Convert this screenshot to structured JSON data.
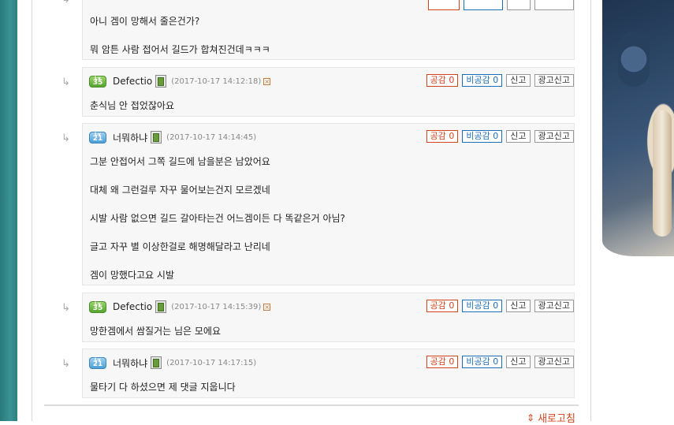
{
  "labels": {
    "like": "공감",
    "dislike": "비공감",
    "report": "신고",
    "ad_report": "광고신고",
    "refresh": "새로고침"
  },
  "comments": [
    {
      "level": "",
      "nickname": "",
      "date": "",
      "likes": "",
      "dislikes": "",
      "lines": [
        "아니 겜이 망해서 줄은건가?",
        "뭐 암튼 사람 접어서 길드가 합쳐진건데ㅋㅋㅋ"
      ]
    },
    {
      "level": "35",
      "nickname": "Defectio",
      "date": "(2017-10-17 14:12:18)",
      "likes": "0",
      "dislikes": "0",
      "lines": [
        "춘식님 안 접었잖아요"
      ]
    },
    {
      "level": "21",
      "nickname": "너뭐하냐",
      "date": "(2017-10-17 14:14:45)",
      "likes": "0",
      "dislikes": "0",
      "lines": [
        "그분 안접어서 그쪽 길드에 남을분은 남았어요",
        "대체 왜 그런걸루 자꾸 물어보는건지 모르겠네",
        "시발 사람 없으면 길드 갈아타는건 어느겜이든 다 똑같은거 아님?",
        "글고 자꾸 별 이상한걸로 해명해달라고 난리네",
        "겜이 망했다고요 시발"
      ]
    },
    {
      "level": "35",
      "nickname": "Defectio",
      "date": "(2017-10-17 14:15:39)",
      "likes": "0",
      "dislikes": "0",
      "lines": [
        "망한겜에서 쌈질거는 님은 모에요"
      ]
    },
    {
      "level": "21",
      "nickname": "너뭐하냐",
      "date": "(2017-10-17 14:17:15)",
      "likes": "0",
      "dislikes": "0",
      "lines": [
        "물타기 다 하셨으면 제 댓글 지웁니다"
      ]
    }
  ]
}
